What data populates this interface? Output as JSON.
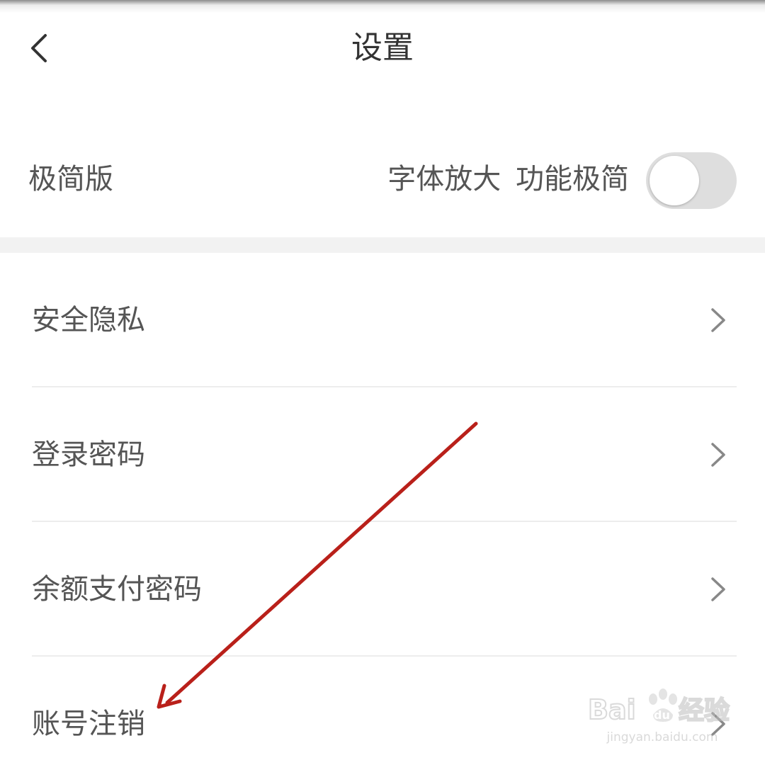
{
  "header": {
    "title": "设置",
    "back_icon": "chevron-left-icon"
  },
  "lite_mode": {
    "title": "极简版",
    "description": "字体放大 功能极简",
    "enabled": false
  },
  "menu": {
    "items": [
      {
        "label": "安全隐私",
        "icon": "chevron-right-icon"
      },
      {
        "label": "登录密码",
        "icon": "chevron-right-icon"
      },
      {
        "label": "余额支付密码",
        "icon": "chevron-right-icon"
      },
      {
        "label": "账号注销",
        "icon": "chevron-right-icon"
      }
    ]
  },
  "annotation": {
    "color": "#b9201a"
  },
  "watermark": {
    "brand": "Baidu 经验",
    "url": "jingyan.baidu.com"
  }
}
